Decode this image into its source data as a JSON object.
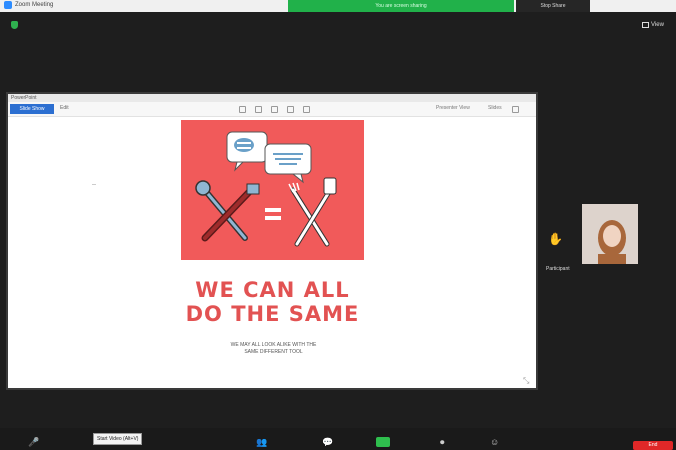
{
  "titlebar": {
    "app_title": "Zoom Meeting"
  },
  "share_banner": {
    "text": "You are screen sharing",
    "stop_label": "Stop Share"
  },
  "view": {
    "label": "View"
  },
  "shared_window": {
    "title": "PowerPoint",
    "primary_button": "Slide Show",
    "secondary_label": "Edit",
    "right_label_1": "Presenter View",
    "right_label_2": "Slides"
  },
  "slide": {
    "headline_line1": "WE CAN ALL",
    "headline_line2": "DO THE SAME",
    "caption_line1": "WE MAY ALL LOOK ALIKE WITH THE",
    "caption_line2": "SAME DIFFERENT TOOL"
  },
  "participant": {
    "name": "Participant"
  },
  "toolbar": {
    "tooltip": "Start Video (Alt+V)",
    "end_label": "End"
  },
  "colors": {
    "slide_red": "#f15a5a",
    "headline_red": "#e25252",
    "share_green": "#21b14a",
    "end_red": "#e02828",
    "accent_blue": "#2c6fd1"
  }
}
